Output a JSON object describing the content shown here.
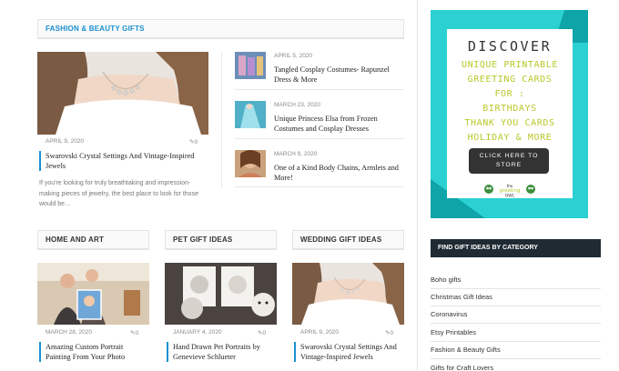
{
  "featured_section": {
    "heading": "Fashion & Beauty Gifts",
    "main_post": {
      "date": "April 9, 2020",
      "comments": "0",
      "title": "Swarovski Crystal Settings And Vintage-Inspired Jewels",
      "excerpt": "If you're looking for truly breathtaking and impression-making pieces of jewelry, the best place to look for those would be…"
    },
    "side_posts": [
      {
        "date": "April 5, 2020",
        "title": "Tangled Cosplay Costumes- Rapunzel Dress & More"
      },
      {
        "date": "March 23, 2020",
        "title": "Unique Princess Elsa from Frozen Costumes and Cosplay Dresses"
      },
      {
        "date": "March 9, 2020",
        "title": "One of a Kind Body Chains, Armlets and More!"
      }
    ]
  },
  "columns": [
    {
      "heading": "Home and Art",
      "date": "March 28, 2020",
      "comments": "0",
      "title": "Amazing Custom Portrait Painting From Your Photo"
    },
    {
      "heading": "Pet Gift Ideas",
      "date": "January 4, 2020",
      "comments": "0",
      "title": "Hand Drawn Pet Portraits by Genevieve Schlueter"
    },
    {
      "heading": "Wedding Gift Ideas",
      "date": "April 9, 2020",
      "comments": "0",
      "title": "Swarovski Crystal Settings And Vintage-Inspired Jewels"
    }
  ],
  "ad": {
    "title": "DISCOVER",
    "lines": [
      "UNIQUE PRINTABLE",
      "GREETING CARDS",
      "FOR :",
      "BIRTHDAYS",
      "THANK YOU CARDS",
      "HOLIDAY & MORE"
    ],
    "button": "CLICK HERE TO STORE",
    "logo": "the greeting OWL"
  },
  "categories": {
    "heading": "Find Gift Ideas By Category",
    "items": [
      "Boho gifts",
      "Christmas Gift Ideas",
      "Coronavirus",
      "Etsy Printables",
      "Fashion & Beauty Gifts",
      "Gifts for Craft Lovers"
    ]
  },
  "colors": {
    "accent": "#1a8fd0",
    "ad_cyan": "#2bd0d3",
    "ad_teal": "#0fa4a8",
    "ad_yellow": "#b8c82a",
    "widget_dark": "#1f2a33"
  }
}
